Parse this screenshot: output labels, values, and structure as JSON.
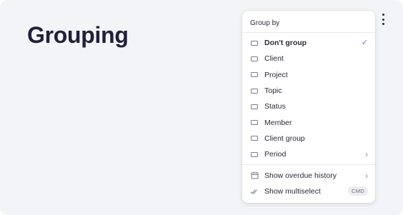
{
  "page": {
    "title": "Grouping"
  },
  "menu": {
    "header": "Group by",
    "options": [
      {
        "label": "Don't group",
        "selected": true
      },
      {
        "label": "Client"
      },
      {
        "label": "Project"
      },
      {
        "label": "Topic"
      },
      {
        "label": "Status"
      },
      {
        "label": "Member"
      },
      {
        "label": "Client group"
      },
      {
        "label": "Period",
        "submenu": true
      }
    ],
    "extras": [
      {
        "label": "Show overdue history",
        "icon": "calendar-icon",
        "submenu": true
      },
      {
        "label": "Show multiselect",
        "icon": "double-check-icon",
        "shortcut": "CMD"
      }
    ]
  },
  "colors": {
    "accent": "#4a78e0",
    "title": "#21203a",
    "background": "#f3f4f7"
  }
}
